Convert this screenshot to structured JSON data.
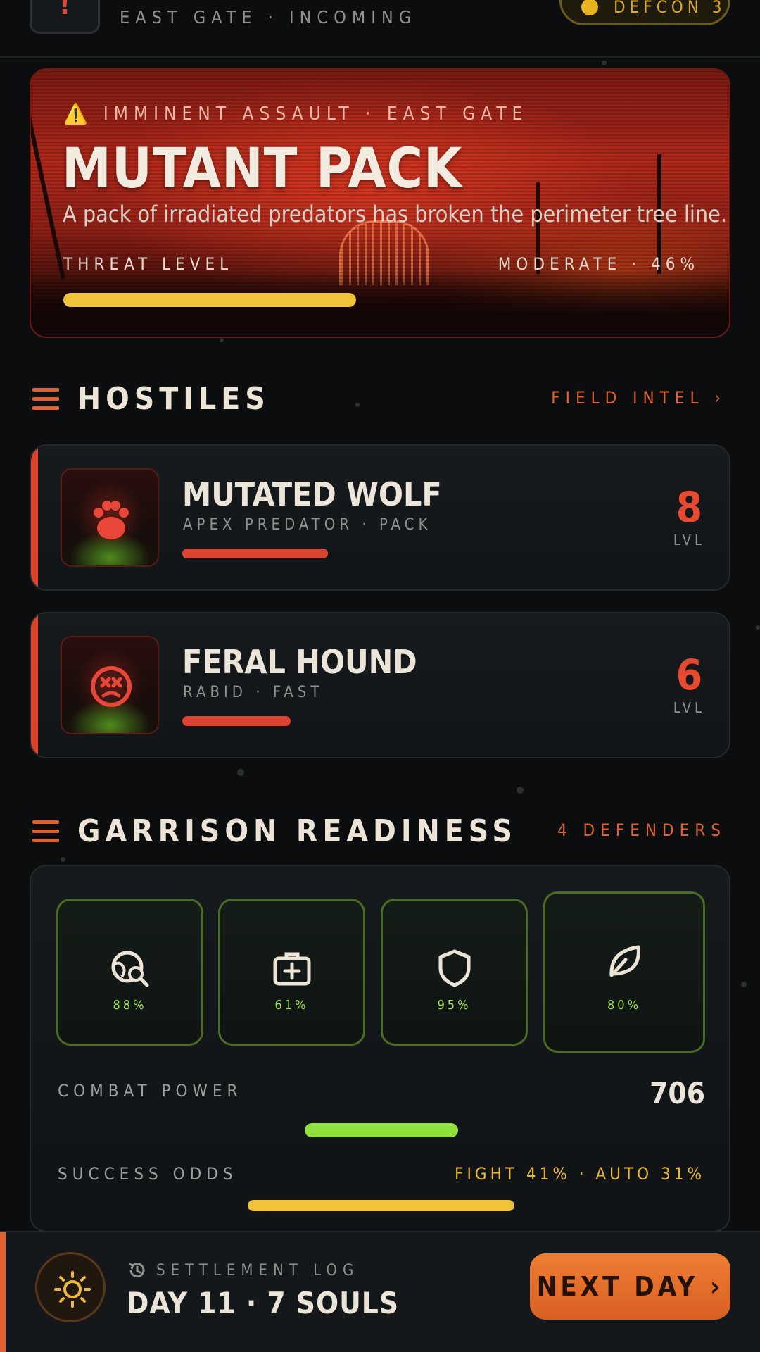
{
  "topbar": {
    "alert_glyph": "!",
    "location": "EAST GATE · INCOMING",
    "defcon": "DEFCON 3"
  },
  "hero": {
    "kicker": "IMMINENT ASSAULT · EAST GATE",
    "title": "MUTANT PACK",
    "description": "A pack of irradiated predators has broken the perimeter tree line.",
    "threat_label": "THREAT LEVEL",
    "threat_value": "MODERATE · 46%",
    "threat_percent": 46
  },
  "hostiles": {
    "title": "HOSTILES",
    "link": "FIELD INTEL ›",
    "items": [
      {
        "name": "MUTATED WOLF",
        "tags": "APEX PREDATOR · PACK",
        "level": "8",
        "level_label": "LVL",
        "health": 0.81,
        "icon": "paw-icon"
      },
      {
        "name": "FERAL HOUND",
        "tags": "RABID · FAST",
        "level": "6",
        "level_label": "LVL",
        "health": 0.6,
        "icon": "dead-face-icon"
      }
    ]
  },
  "garrison": {
    "title": "GARRISON READINESS",
    "link": "4 DEFENDERS",
    "stats": [
      {
        "icon": "scout-search-icon",
        "value": "88%"
      },
      {
        "icon": "medkit-icon",
        "value": "61%"
      },
      {
        "icon": "shield-icon",
        "value": "95%"
      },
      {
        "icon": "leaf-icon",
        "value": "80%"
      }
    ],
    "power_label": "COMBAT POWER",
    "power_value": "706",
    "odds_label": "SUCCESS ODDS",
    "odds_value": "FIGHT 41% · AUTO 31%"
  },
  "footer": {
    "log_label": "SETTLEMENT LOG",
    "day": "DAY 11 · 7 SOULS",
    "next_button": "NEXT DAY ›"
  },
  "colors": {
    "accent": "#e0612e",
    "danger": "#dc4432",
    "ready": "#8fe03a",
    "warning": "#f0c33a"
  }
}
